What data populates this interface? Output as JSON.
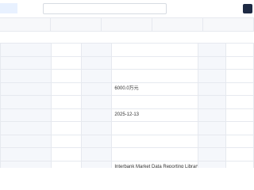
{
  "header": {
    "badge": "",
    "company_name": "",
    "right_link": ""
  },
  "tabs": [
    {
      "label": ""
    },
    {
      "label": ""
    },
    {
      "label": ""
    },
    {
      "label": ""
    },
    {
      "label": ""
    }
  ],
  "section_title": "",
  "table": {
    "rows": [
      [
        "",
        "",
        "",
        "",
        "",
        ""
      ],
      [
        "",
        "",
        "",
        "",
        "",
        ""
      ],
      [
        "",
        "",
        "",
        "",
        "",
        ""
      ],
      [
        "",
        "",
        "",
        "6000.0万元",
        "",
        ""
      ],
      [
        "",
        "",
        "",
        "",
        "",
        ""
      ],
      [
        "",
        "",
        "",
        "2025-12-13",
        "",
        ""
      ],
      [
        "",
        "",
        "",
        "",
        "",
        ""
      ],
      [
        "",
        "",
        "",
        "",
        "",
        ""
      ],
      [
        "",
        "",
        "",
        "",
        "",
        ""
      ],
      [
        "",
        "",
        "",
        "Interbank Market Data Reporting Library (Shanghai) Co., Ltd.",
        "",
        ""
      ]
    ]
  },
  "footer": {
    "line1": "",
    "line2": ""
  }
}
